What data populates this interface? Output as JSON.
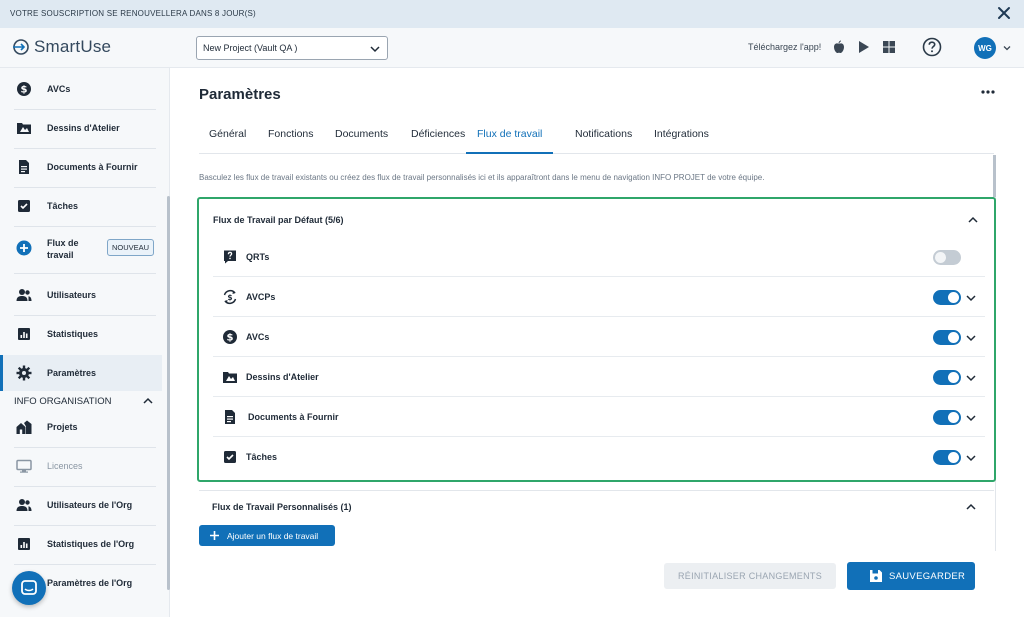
{
  "banner": {
    "text": "VOTRE SOUSCRIPTION SE RENOUVELLERA DANS 8 JOUR(S)"
  },
  "header": {
    "logo_text": "SmartUse",
    "project_select": "New Project (Vault QA )",
    "download_text": "Téléchargez l'app!",
    "avatar_initials": "WG"
  },
  "sidebar": {
    "items": [
      {
        "label": "AVCs",
        "icon": "dollar-icon"
      },
      {
        "label": "Dessins d'Atelier",
        "icon": "shop-drawing-icon"
      },
      {
        "label": "Documents à Fournir",
        "icon": "document-icon"
      },
      {
        "label": "Tâches",
        "icon": "checkbox-icon"
      },
      {
        "label": "Flux de travail",
        "icon": "plus-circle-icon",
        "badge": "NOUVEAU"
      },
      {
        "label": "Utilisateurs",
        "icon": "users-icon"
      },
      {
        "label": "Statistiques",
        "icon": "chart-icon"
      },
      {
        "label": "Paramètres",
        "icon": "gear-icon"
      }
    ],
    "org_section_title": "INFO ORGANISATION",
    "org_items": [
      {
        "label": "Projets",
        "icon": "buildings-icon"
      },
      {
        "label": "Licences",
        "icon": "monitor-icon"
      },
      {
        "label": "Utilisateurs de l'Org",
        "icon": "users-icon"
      },
      {
        "label": "Statistiques de l'Org",
        "icon": "chart-icon"
      },
      {
        "label": "Paramètres de l'Org",
        "icon": "gear-icon"
      }
    ]
  },
  "page": {
    "title": "Paramètres"
  },
  "tabs": [
    {
      "label": "Général"
    },
    {
      "label": "Fonctions"
    },
    {
      "label": "Documents"
    },
    {
      "label": "Déficiences"
    },
    {
      "label": "Flux de travail",
      "active": true
    },
    {
      "label": "Notifications"
    },
    {
      "label": "Intégrations"
    }
  ],
  "info_text": "Basculez les flux de travail existants ou créez des flux de travail personnalisés ici et ils apparaîtront dans le menu de navigation INFO PROJET de votre équipe.",
  "default_workflows": {
    "title": "Flux de Travail par Défaut (5/6)",
    "items": [
      {
        "label": "QRTs",
        "enabled": false
      },
      {
        "label": "AVCPs",
        "enabled": true
      },
      {
        "label": "AVCs",
        "enabled": true
      },
      {
        "label": "Dessins d'Atelier",
        "enabled": true
      },
      {
        "label": "Documents à Fournir",
        "enabled": true
      },
      {
        "label": "Tâches",
        "enabled": true
      }
    ]
  },
  "custom_workflows": {
    "title": "Flux de Travail Personnalisés (1)",
    "add_button": "Ajouter un flux de travail"
  },
  "footer": {
    "reset_label": "RÉINITIALISER CHANGEMENTS",
    "save_label": "SAUVEGARDER"
  },
  "colors": {
    "brand": "#1170b8",
    "highlight_border": "#2fa66a",
    "sidebar_bg": "#f6f8fa"
  }
}
